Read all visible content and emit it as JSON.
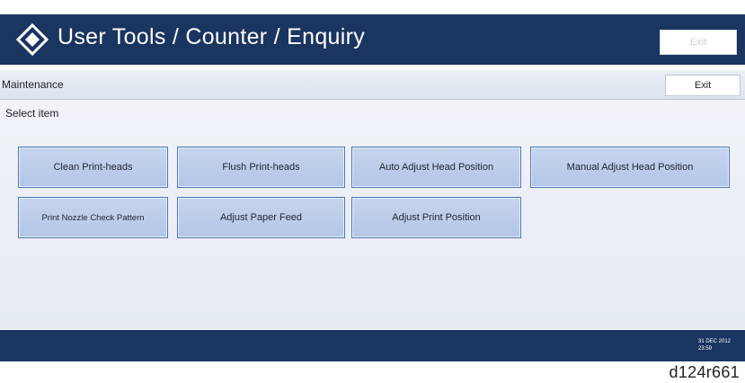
{
  "header": {
    "title": "User Tools / Counter / Enquiry",
    "exit_label": "Exit",
    "logo_icon": "ricoh-diamond-icon"
  },
  "maintenance_bar": {
    "title": "Maintenance",
    "exit_label": "Exit"
  },
  "content": {
    "prompt": "Select item",
    "buttons": [
      {
        "label": "Clean Print-heads"
      },
      {
        "label": "Flush Print-heads"
      },
      {
        "label": "Auto Adjust Head Position"
      },
      {
        "label": "Manual Adjust Head Position"
      },
      {
        "label": "Print Nozzle Check Pattern"
      },
      {
        "label": "Adjust Paper Feed"
      },
      {
        "label": "Adjust Print Position"
      }
    ]
  },
  "status_bar": {
    "date": "31 DEC 2012",
    "time": "23:59"
  },
  "figure_id": "d124r661",
  "colors": {
    "header_bg": "#1a3560",
    "button_fill": "#b9cbe9",
    "button_border": "#4f78b2"
  }
}
